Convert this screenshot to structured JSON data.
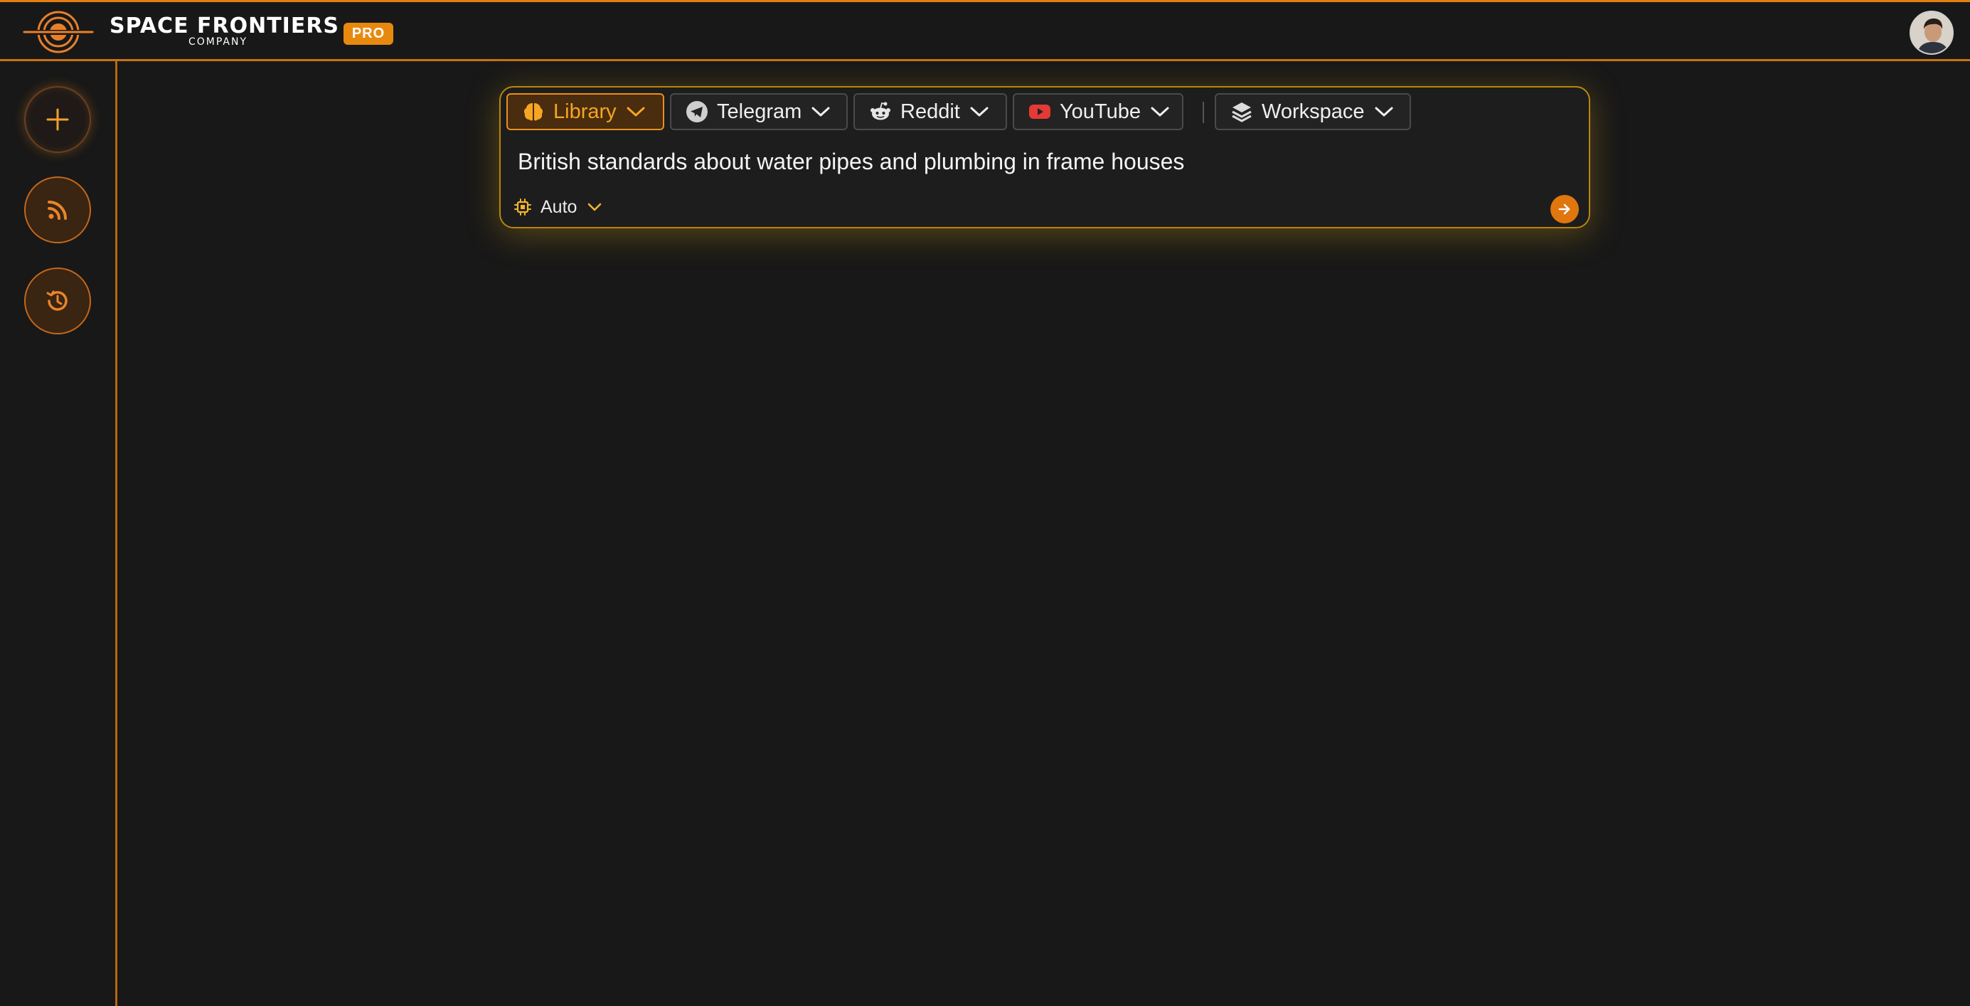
{
  "header": {
    "brand_name": "SPACE FRONTIERS",
    "brand_subtitle": "COMPANY",
    "pro_badge": "PRO",
    "logo_icon": "planet-logo-icon",
    "avatar_icon": "user-avatar"
  },
  "sidebar": {
    "items": [
      {
        "name": "new-search",
        "icon": "plus-icon"
      },
      {
        "name": "feed",
        "icon": "rss-icon"
      },
      {
        "name": "history",
        "icon": "history-icon"
      }
    ]
  },
  "search": {
    "sources": [
      {
        "label": "Library",
        "icon": "brain-icon",
        "active": true
      },
      {
        "label": "Telegram",
        "icon": "telegram-icon",
        "active": false
      },
      {
        "label": "Reddit",
        "icon": "reddit-icon",
        "active": false
      },
      {
        "label": "YouTube",
        "icon": "youtube-icon",
        "active": false
      },
      {
        "label": "Workspace",
        "icon": "layers-icon",
        "active": false
      }
    ],
    "query": "British standards about water pipes and plumbing in frame houses",
    "model": "Auto",
    "model_icon": "cpu-chip-icon",
    "submit_icon": "arrow-right-icon"
  },
  "colors": {
    "accent": "#e8890f",
    "active_tab_bg": "#4a2c0e",
    "active_tab_text": "#f5a623",
    "card_border": "#b8860b",
    "background": "#181818",
    "youtube_red": "#e53935"
  }
}
